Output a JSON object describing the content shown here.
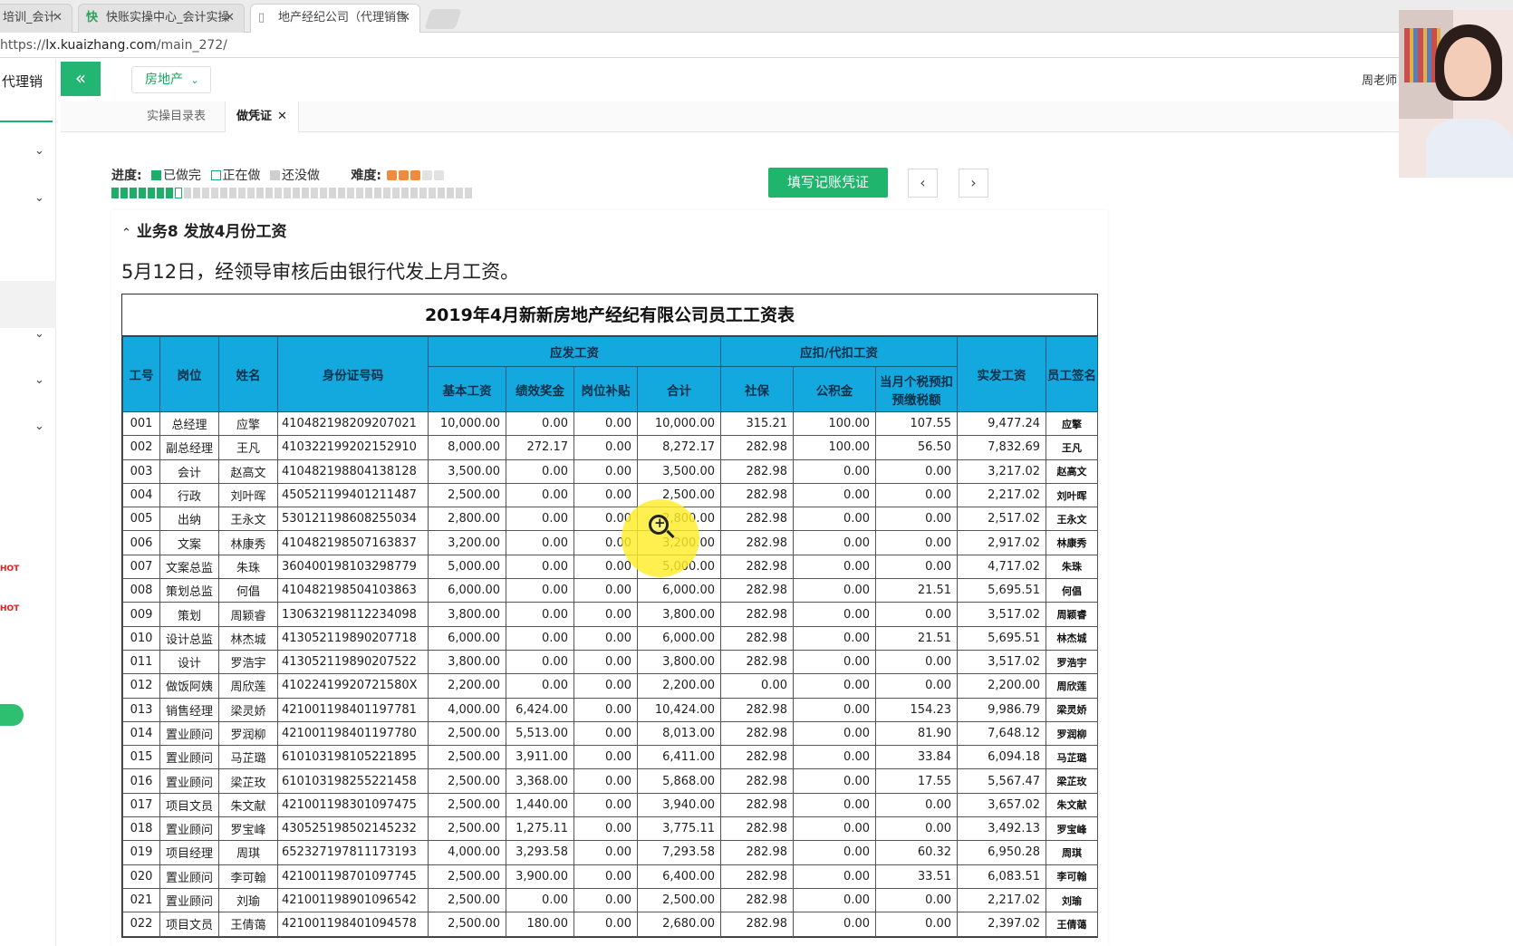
{
  "browser": {
    "tabs": [
      {
        "label": "培训_会计",
        "active": false
      },
      {
        "label": "快账实操中心_会计实操",
        "active": false
      },
      {
        "label": "地产经纪公司（代理销售",
        "active": true
      }
    ],
    "url_scheme": "https://",
    "url_host": "lx.kuaizhang.com",
    "url_path": "/main_272/"
  },
  "sidebar": {
    "title": "代理销",
    "hot_label": "HOT"
  },
  "header": {
    "collapse_icon": "«",
    "category": "房地产",
    "teacher": "周老师"
  },
  "app_tabs": [
    {
      "label": "实操目录表",
      "active": false
    },
    {
      "label": "做凭证",
      "active": true
    }
  ],
  "progress": {
    "label": "进度:",
    "legend_done": "已做完",
    "legend_doing": "正在做",
    "legend_todo": "还没做",
    "difficulty_label": "难度:",
    "difficulty_level": 3,
    "difficulty_max": 5,
    "done_count": 7,
    "current_index": 8,
    "total_count": 40
  },
  "actions": {
    "fill_voucher": "填写记账凭证",
    "prev": "‹",
    "next": "›"
  },
  "business": {
    "title": "业务8 发放4月份工资",
    "description": "5月12日，经领导审核后由银行代发上月工资。"
  },
  "payroll": {
    "title": "2019年4月新新房地产经纪有限公司员工工资表",
    "headers": {
      "emp_no": "工号",
      "position": "岗位",
      "name": "姓名",
      "id_no": "身份证号码",
      "payable_group": "应发工资",
      "basic": "基本工资",
      "bonus": "绩效奖金",
      "allowance": "岗位补贴",
      "total": "合计",
      "deduct_group": "应扣/代扣工资",
      "social": "社保",
      "fund": "公积金",
      "tax": "当月个税预扣预缴税额",
      "net": "实发工资",
      "sign": "员工签名"
    },
    "rows": [
      [
        "001",
        "总经理",
        "应擎",
        "410482198209207021",
        "10,000.00",
        "0.00",
        "0.00",
        "10,000.00",
        "315.21",
        "100.00",
        "107.55",
        "9,477.24",
        "应擎"
      ],
      [
        "002",
        "副总经理",
        "王凡",
        "410322199202152910",
        "8,000.00",
        "272.17",
        "0.00",
        "8,272.17",
        "282.98",
        "100.00",
        "56.50",
        "7,832.69",
        "王凡"
      ],
      [
        "003",
        "会计",
        "赵高文",
        "410482198804138128",
        "3,500.00",
        "0.00",
        "0.00",
        "3,500.00",
        "282.98",
        "0.00",
        "0.00",
        "3,217.02",
        "赵高文"
      ],
      [
        "004",
        "行政",
        "刘叶晖",
        "450521199401211487",
        "2,500.00",
        "0.00",
        "0.00",
        "2,500.00",
        "282.98",
        "0.00",
        "0.00",
        "2,217.02",
        "刘叶晖"
      ],
      [
        "005",
        "出纳",
        "王永文",
        "530121198608255034",
        "2,800.00",
        "0.00",
        "0.00",
        "2,800.00",
        "282.98",
        "0.00",
        "0.00",
        "2,517.02",
        "王永文"
      ],
      [
        "006",
        "文案",
        "林康秀",
        "410482198507163837",
        "3,200.00",
        "0.00",
        "0.00",
        "3,200.00",
        "282.98",
        "0.00",
        "0.00",
        "2,917.02",
        "林康秀"
      ],
      [
        "007",
        "文案总监",
        "朱珠",
        "360400198103298779",
        "5,000.00",
        "0.00",
        "0.00",
        "5,000.00",
        "282.98",
        "0.00",
        "0.00",
        "4,717.02",
        "朱珠"
      ],
      [
        "008",
        "策划总监",
        "何倡",
        "410482198504103863",
        "6,000.00",
        "0.00",
        "0.00",
        "6,000.00",
        "282.98",
        "0.00",
        "21.51",
        "5,695.51",
        "何倡"
      ],
      [
        "009",
        "策划",
        "周颖睿",
        "130632198112234098",
        "3,800.00",
        "0.00",
        "0.00",
        "3,800.00",
        "282.98",
        "0.00",
        "0.00",
        "3,517.02",
        "周颖睿"
      ],
      [
        "010",
        "设计总监",
        "林杰城",
        "413052119890207718",
        "6,000.00",
        "0.00",
        "0.00",
        "6,000.00",
        "282.98",
        "0.00",
        "21.51",
        "5,695.51",
        "林杰城"
      ],
      [
        "011",
        "设计",
        "罗浩宇",
        "413052119890207522",
        "3,800.00",
        "0.00",
        "0.00",
        "3,800.00",
        "282.98",
        "0.00",
        "0.00",
        "3,517.02",
        "罗浩宇"
      ],
      [
        "012",
        "做饭阿姨",
        "周欣莲",
        "41022419920721580X",
        "2,200.00",
        "0.00",
        "0.00",
        "2,200.00",
        "0.00",
        "0.00",
        "0.00",
        "2,200.00",
        "周欣莲"
      ],
      [
        "013",
        "销售经理",
        "梁灵娇",
        "421001198401197781",
        "4,000.00",
        "6,424.00",
        "0.00",
        "10,424.00",
        "282.98",
        "0.00",
        "154.23",
        "9,986.79",
        "梁灵娇"
      ],
      [
        "014",
        "置业顾问",
        "罗润柳",
        "421001198401197780",
        "2,500.00",
        "5,513.00",
        "0.00",
        "8,013.00",
        "282.98",
        "0.00",
        "81.90",
        "7,648.12",
        "罗润柳"
      ],
      [
        "015",
        "置业顾问",
        "马芷璐",
        "610103198105221895",
        "2,500.00",
        "3,911.00",
        "0.00",
        "6,411.00",
        "282.98",
        "0.00",
        "33.84",
        "6,094.18",
        "马芷璐"
      ],
      [
        "016",
        "置业顾问",
        "梁芷玫",
        "610103198255221458",
        "2,500.00",
        "3,368.00",
        "0.00",
        "5,868.00",
        "282.98",
        "0.00",
        "17.55",
        "5,567.47",
        "梁芷玫"
      ],
      [
        "017",
        "项目文员",
        "朱文献",
        "421001198301097475",
        "2,500.00",
        "1,440.00",
        "0.00",
        "3,940.00",
        "282.98",
        "0.00",
        "0.00",
        "3,657.02",
        "朱文献"
      ],
      [
        "018",
        "置业顾问",
        "罗宝峰",
        "430525198502145232",
        "2,500.00",
        "1,275.11",
        "0.00",
        "3,775.11",
        "282.98",
        "0.00",
        "0.00",
        "3,492.13",
        "罗宝峰"
      ],
      [
        "019",
        "项目经理",
        "周琪",
        "652327197811173193",
        "4,000.00",
        "3,293.58",
        "0.00",
        "7,293.58",
        "282.98",
        "0.00",
        "60.32",
        "6,950.28",
        "周琪"
      ],
      [
        "020",
        "置业顾问",
        "李可翰",
        "421001198701097745",
        "2,500.00",
        "3,900.00",
        "0.00",
        "6,400.00",
        "282.98",
        "0.00",
        "33.51",
        "6,083.51",
        "李可翰"
      ],
      [
        "021",
        "置业顾问",
        "刘瑜",
        "421001198901096542",
        "2,500.00",
        "0.00",
        "0.00",
        "2,500.00",
        "282.98",
        "0.00",
        "0.00",
        "2,217.02",
        "刘瑜"
      ],
      [
        "022",
        "项目文员",
        "王倩蔼",
        "421001198401094578",
        "2,500.00",
        "180.00",
        "0.00",
        "2,680.00",
        "282.98",
        "0.00",
        "0.00",
        "2,397.02",
        "王倩蔼"
      ]
    ]
  },
  "colors": {
    "accent_green": "#1fb56d",
    "table_header_blue": "#14a9de"
  }
}
